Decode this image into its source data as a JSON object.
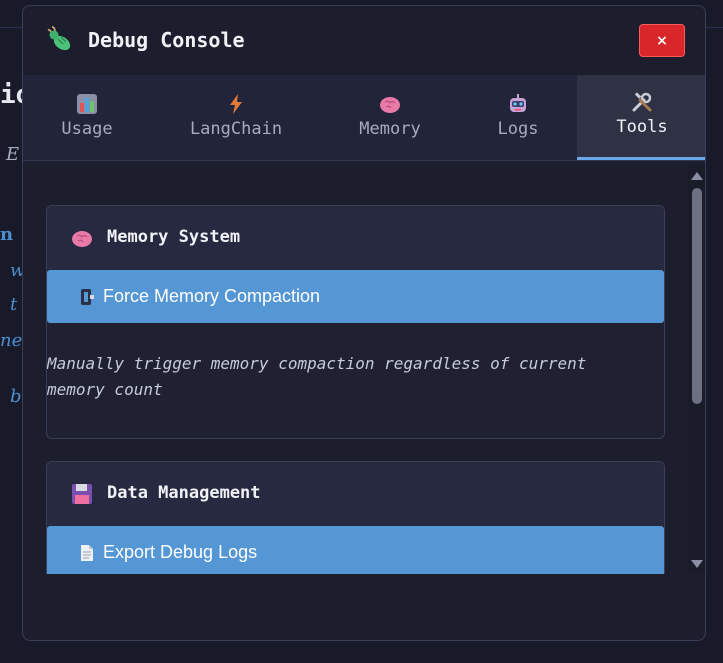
{
  "background": {
    "fragments": [
      "io",
      "E",
      "n",
      "w",
      "t",
      "ne",
      "b"
    ]
  },
  "modal": {
    "title": "Debug Console",
    "close_label": "×",
    "tabs": [
      {
        "label": "Usage",
        "icon": "bar-chart-icon",
        "active": false
      },
      {
        "label": "LangChain",
        "icon": "lightning-icon",
        "active": false
      },
      {
        "label": "Memory",
        "icon": "brain-icon",
        "active": false
      },
      {
        "label": "Logs",
        "icon": "robot-icon",
        "active": false
      },
      {
        "label": "Tools",
        "icon": "tools-icon",
        "active": true
      }
    ],
    "sections": [
      {
        "title": "Memory System",
        "icon": "brain-icon",
        "button_label": "Force Memory Compaction",
        "button_icon": "compress-icon",
        "description": "Manually trigger memory compaction regardless of current memory count"
      },
      {
        "title": "Data Management",
        "icon": "floppy-disk-icon",
        "button_label": "Export Debug Logs",
        "button_icon": "document-icon"
      }
    ]
  },
  "colors": {
    "accent": "#5596d4",
    "close": "#d8262b",
    "background": "#181a2a"
  }
}
